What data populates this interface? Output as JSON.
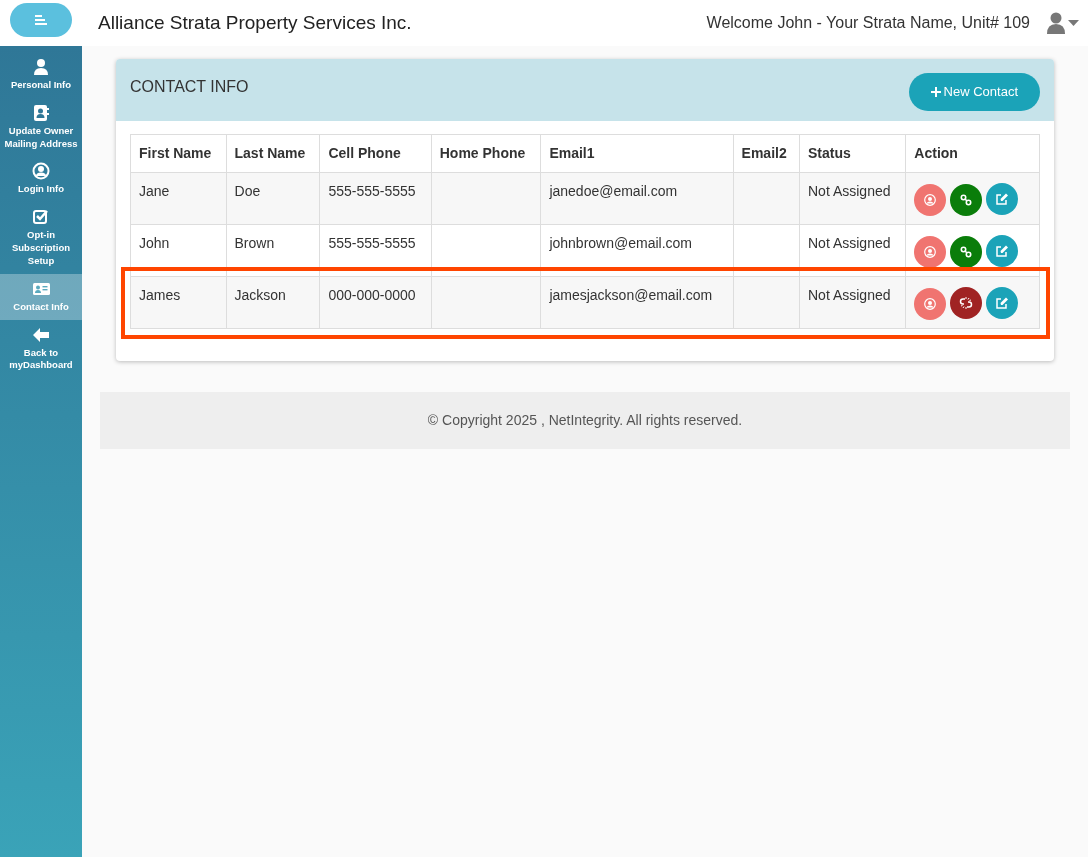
{
  "header": {
    "title": "Alliance Strata Property Services Inc.",
    "welcome": "Welcome John - Your Strata Name, Unit# 109"
  },
  "sidebar": {
    "items": [
      {
        "label": "Personal Info",
        "kind": "person",
        "selected": false
      },
      {
        "label": "Update Owner Mailing Address",
        "kind": "addressbook",
        "selected": false
      },
      {
        "label": "Login Info",
        "kind": "usercircle",
        "selected": false
      },
      {
        "label": "Opt-in Subscription Setup",
        "kind": "checkbox",
        "selected": false
      },
      {
        "label": "Contact Info",
        "kind": "card",
        "selected": true
      },
      {
        "label": "Back to myDashboard",
        "kind": "back",
        "selected": false
      }
    ]
  },
  "card": {
    "title": "CONTACT INFO",
    "new_button": "New Contact",
    "table": {
      "columns": [
        "First Name",
        "Last Name",
        "Cell Phone",
        "Home Phone",
        "Email1",
        "Email2",
        "Status",
        "Action"
      ],
      "rows": [
        {
          "cells": [
            "Jane",
            "Doe",
            "555-555-5555",
            "",
            "janedoe@email.com",
            "",
            "Not Assigned"
          ],
          "linked": true,
          "highlighted": false
        },
        {
          "cells": [
            "John",
            "Brown",
            "555-555-5555",
            "",
            "johnbrown@email.com",
            "",
            "Not Assigned"
          ],
          "linked": true,
          "highlighted": false
        },
        {
          "cells": [
            "James",
            "Jackson",
            "000-000-0000",
            "",
            "jamesjackson@email.com",
            "",
            "Not Assigned"
          ],
          "linked": false,
          "highlighted": true
        }
      ]
    }
  },
  "footer": "© Copyright 2025 , NetIntegrity. All rights reserved."
}
